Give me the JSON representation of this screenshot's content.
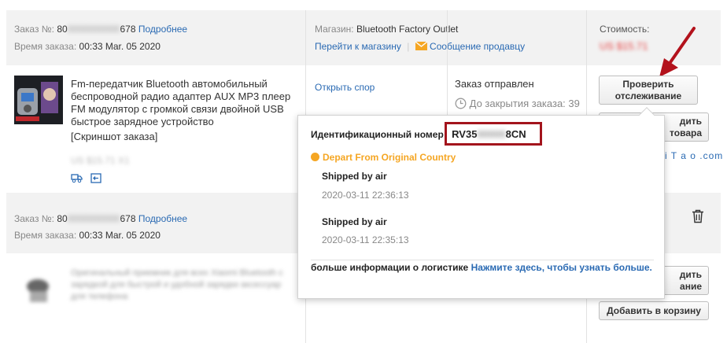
{
  "order1": {
    "number_label": "Заказ №:",
    "number_prefix": "80",
    "number_hidden": "0000000000",
    "number_suffix": "678",
    "details_link": "Подробнее",
    "time_label": "Время заказа:",
    "time_value": "00:33 Mar. 05 2020",
    "store_label": "Магазин:",
    "store_name": "Bluetooth Factory Outlet",
    "go_to_store": "Перейти к магазину",
    "separator": "|",
    "message_seller": "Сообщение продавцу",
    "cost_label": "Стоимость:",
    "cost_value": "US $15.71",
    "product_title": "Fm-передатчик Bluetooth автомобильный беспроводной радио адаптер AUX MP3 плеер FM модулятор с громкой связи двойной USB быстрое зарядное устройство",
    "screenshot_label": "[Скриншот заказа]",
    "price_blurred": "US $15.71 X1",
    "open_dispute": "Открыть спор",
    "status": "Заказ отправлен",
    "countdown": "До закрытия заказа: 39",
    "track_button": "Проверить отслеживание",
    "confirm_button_partial": "дить",
    "confirm_button_partial2": "товара",
    "brand_snippet": "i T a o .com"
  },
  "popup": {
    "tracking_label": "Идентификационный номер:",
    "tracking_prefix": "RV35",
    "tracking_hidden": "00000",
    "tracking_suffix": "8CN",
    "status_title": "Depart From Original Country",
    "events": [
      {
        "title": "Shipped by air",
        "time": "2020-03-11 22:36:13"
      },
      {
        "title": "Shipped by air",
        "time": "2020-03-11 22:35:13"
      }
    ],
    "more_info_label": "больше информации о логистике",
    "more_info_link": "Нажмите здесь, чтобы узнать больше."
  },
  "order2": {
    "number_label": "Заказ №:",
    "number_prefix": "80",
    "number_hidden": "0000000000",
    "number_suffix": "678",
    "details_link": "Подробнее",
    "time_label": "Время заказа:",
    "time_value": "00:33 Mar. 05 2020",
    "product_blurred": "Оригинальный приемник для всех Xiaomi Bluetooth с зарядкой для быстрой и удобной зарядки аксессуар для телефона",
    "confirm_partial": "дить",
    "confirm_partial2": "ание",
    "add_to_cart": "Добавить в корзину"
  },
  "colors": {
    "link": "#2a6ab3",
    "header_bg": "#f2f2f2",
    "highlight_red": "#a3141c",
    "status_orange": "#f5a623",
    "price_red": "#e63c3c"
  }
}
